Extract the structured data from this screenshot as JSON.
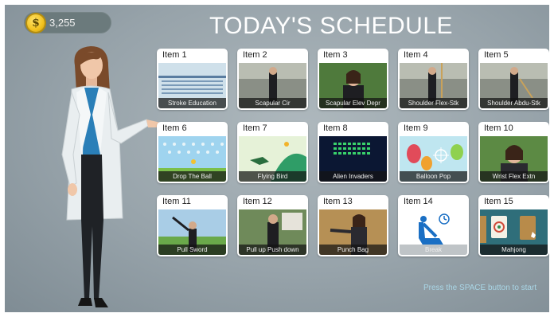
{
  "coins": {
    "amount": "3,255",
    "symbol": "$"
  },
  "title": "TODAY'S SCHEDULE",
  "items": [
    {
      "label": "Item 1",
      "name": "Stroke Education"
    },
    {
      "label": "Item 2",
      "name": "Scapular Cir"
    },
    {
      "label": "Item 3",
      "name": "Scapular Elev Depr"
    },
    {
      "label": "Item 4",
      "name": "Shoulder Flex-Stk"
    },
    {
      "label": "Item 5",
      "name": "Shoulder Abdu-Stk"
    },
    {
      "label": "Item 6",
      "name": "Drop The Ball"
    },
    {
      "label": "Item 7",
      "name": "Flying Bird"
    },
    {
      "label": "Item 8",
      "name": "Alien Invaders"
    },
    {
      "label": "Item 9",
      "name": "Balloon Pop"
    },
    {
      "label": "Item 10",
      "name": "Wrist Flex Extn"
    },
    {
      "label": "Item 11",
      "name": "Pull Sword"
    },
    {
      "label": "Item 12",
      "name": "Pull up Push down"
    },
    {
      "label": "Item 13",
      "name": "Punch Bag"
    },
    {
      "label": "Item 14",
      "name": "Break"
    },
    {
      "label": "Item 15",
      "name": "Mahjong"
    }
  ],
  "hint": "Press the SPACE  button to start",
  "colors": {
    "accent": "#a9d6e6",
    "coin": "#f3c21e",
    "card": "#ffffff"
  }
}
